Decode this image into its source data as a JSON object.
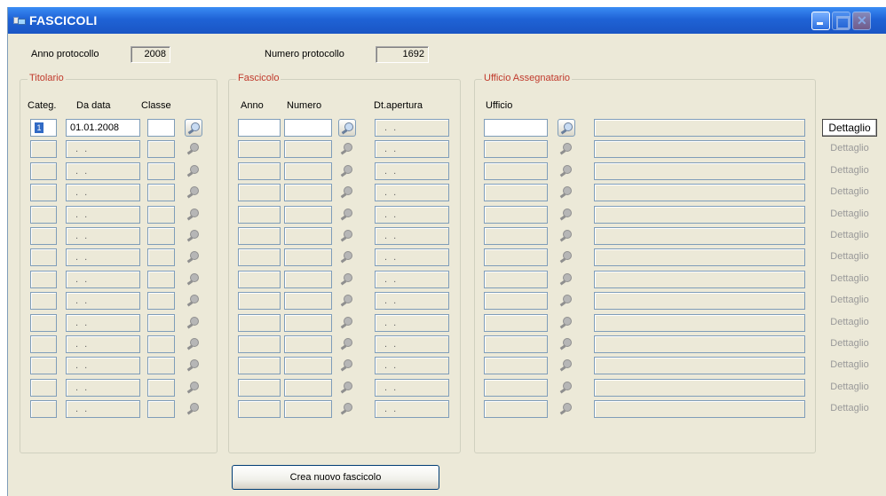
{
  "window": {
    "title": "FASCICOLI"
  },
  "header": {
    "anno_protocollo_label": "Anno protocollo",
    "anno_protocollo_value": "2008",
    "numero_protocollo_label": "Numero protocollo",
    "numero_protocollo_value": "1692"
  },
  "titolario": {
    "title": "Titolario",
    "col_categ": "Categ.",
    "col_da_data": "Da data",
    "col_classe": "Classe",
    "first_row": {
      "categ": "1",
      "da_data": "01.01.2008"
    },
    "empty_date": ". ."
  },
  "fascicolo": {
    "title": "Fascicolo",
    "col_anno": "Anno",
    "col_numero": "Numero",
    "col_dt_apertura": "Dt.apertura",
    "empty_date": ". ."
  },
  "ufficio": {
    "title": "Ufficio Assegnatario",
    "col_ufficio": "Ufficio"
  },
  "rows": 14,
  "dettaglio_label": "Dettaglio",
  "crea_button_label": "Crea nuovo fascicolo",
  "icons": {
    "lookup": "magnifier-icon",
    "window": "window-app-icon"
  },
  "colors": {
    "titlebar": "#1f63d6",
    "group_title": "#c0392b",
    "background": "#ece9d8"
  }
}
